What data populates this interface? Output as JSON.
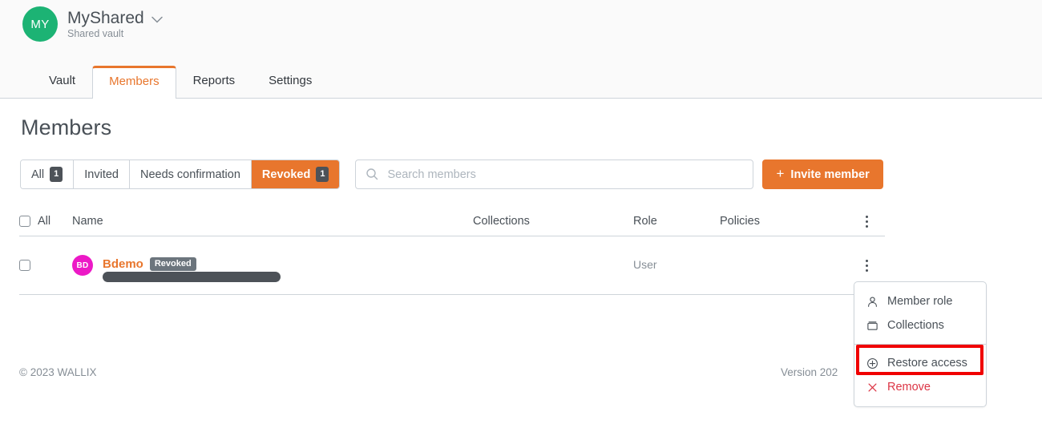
{
  "header": {
    "org": {
      "avatar_initials": "MY",
      "avatar_color": "#1cb374",
      "name": "MyShared",
      "subtitle": "Shared vault",
      "chevron_icon": "chevron-down-icon"
    },
    "tabs": [
      {
        "label": "Vault",
        "active": false
      },
      {
        "label": "Members",
        "active": true
      },
      {
        "label": "Reports",
        "active": false
      },
      {
        "label": "Settings",
        "active": false
      }
    ],
    "accent_color": "#e8762d"
  },
  "page": {
    "title": "Members"
  },
  "toolbar": {
    "filters": [
      {
        "label": "All",
        "count": "1",
        "active": false
      },
      {
        "label": "Invited",
        "count": "",
        "active": false
      },
      {
        "label": "Needs confirmation",
        "count": "",
        "active": false
      },
      {
        "label": "Revoked",
        "count": "1",
        "active": true
      }
    ],
    "search": {
      "placeholder": "Search members",
      "value": "",
      "icon": "search-icon"
    },
    "invite_button": {
      "label": "Invite member",
      "icon": "plus-icon"
    }
  },
  "table": {
    "header": {
      "select_all_label": "All",
      "columns": [
        "Name",
        "Collections",
        "Role",
        "Policies"
      ],
      "menu_icon": "kebab-menu-icon"
    },
    "rows": [
      {
        "avatar_initials": "BD",
        "avatar_color": "#ec19c6",
        "name": "Bdemo",
        "status": "Revoked",
        "email": "",
        "email_redacted": true,
        "collections": "",
        "role": "User",
        "policies": ""
      }
    ]
  },
  "context_menu": {
    "items": [
      {
        "label": "Member role",
        "icon": "person-icon",
        "danger": false
      },
      {
        "label": "Collections",
        "icon": "folder-icon",
        "danger": false
      },
      {
        "label": "Restore access",
        "icon": "plus-circle-icon",
        "danger": false,
        "highlighted": true
      },
      {
        "label": "Remove",
        "icon": "close-x-icon",
        "danger": true
      }
    ],
    "highlight_color": "#f00000"
  },
  "footer": {
    "copyright": "© 2023 WALLIX",
    "version": "Version 202"
  }
}
